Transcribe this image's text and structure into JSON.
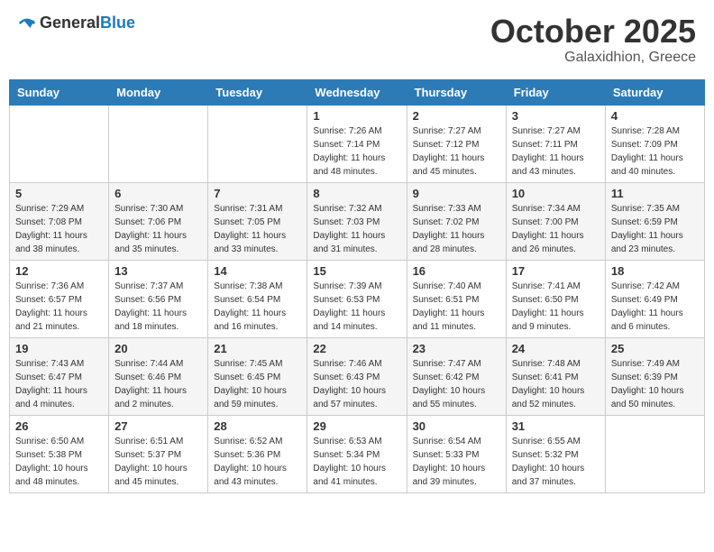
{
  "header": {
    "logo_general": "General",
    "logo_blue": "Blue",
    "month": "October 2025",
    "location": "Galaxidhion, Greece"
  },
  "weekdays": [
    "Sunday",
    "Monday",
    "Tuesday",
    "Wednesday",
    "Thursday",
    "Friday",
    "Saturday"
  ],
  "weeks": [
    [
      {
        "day": "",
        "sunrise": "",
        "sunset": "",
        "daylight": ""
      },
      {
        "day": "",
        "sunrise": "",
        "sunset": "",
        "daylight": ""
      },
      {
        "day": "",
        "sunrise": "",
        "sunset": "",
        "daylight": ""
      },
      {
        "day": "1",
        "sunrise": "Sunrise: 7:26 AM",
        "sunset": "Sunset: 7:14 PM",
        "daylight": "Daylight: 11 hours and 48 minutes."
      },
      {
        "day": "2",
        "sunrise": "Sunrise: 7:27 AM",
        "sunset": "Sunset: 7:12 PM",
        "daylight": "Daylight: 11 hours and 45 minutes."
      },
      {
        "day": "3",
        "sunrise": "Sunrise: 7:27 AM",
        "sunset": "Sunset: 7:11 PM",
        "daylight": "Daylight: 11 hours and 43 minutes."
      },
      {
        "day": "4",
        "sunrise": "Sunrise: 7:28 AM",
        "sunset": "Sunset: 7:09 PM",
        "daylight": "Daylight: 11 hours and 40 minutes."
      }
    ],
    [
      {
        "day": "5",
        "sunrise": "Sunrise: 7:29 AM",
        "sunset": "Sunset: 7:08 PM",
        "daylight": "Daylight: 11 hours and 38 minutes."
      },
      {
        "day": "6",
        "sunrise": "Sunrise: 7:30 AM",
        "sunset": "Sunset: 7:06 PM",
        "daylight": "Daylight: 11 hours and 35 minutes."
      },
      {
        "day": "7",
        "sunrise": "Sunrise: 7:31 AM",
        "sunset": "Sunset: 7:05 PM",
        "daylight": "Daylight: 11 hours and 33 minutes."
      },
      {
        "day": "8",
        "sunrise": "Sunrise: 7:32 AM",
        "sunset": "Sunset: 7:03 PM",
        "daylight": "Daylight: 11 hours and 31 minutes."
      },
      {
        "day": "9",
        "sunrise": "Sunrise: 7:33 AM",
        "sunset": "Sunset: 7:02 PM",
        "daylight": "Daylight: 11 hours and 28 minutes."
      },
      {
        "day": "10",
        "sunrise": "Sunrise: 7:34 AM",
        "sunset": "Sunset: 7:00 PM",
        "daylight": "Daylight: 11 hours and 26 minutes."
      },
      {
        "day": "11",
        "sunrise": "Sunrise: 7:35 AM",
        "sunset": "Sunset: 6:59 PM",
        "daylight": "Daylight: 11 hours and 23 minutes."
      }
    ],
    [
      {
        "day": "12",
        "sunrise": "Sunrise: 7:36 AM",
        "sunset": "Sunset: 6:57 PM",
        "daylight": "Daylight: 11 hours and 21 minutes."
      },
      {
        "day": "13",
        "sunrise": "Sunrise: 7:37 AM",
        "sunset": "Sunset: 6:56 PM",
        "daylight": "Daylight: 11 hours and 18 minutes."
      },
      {
        "day": "14",
        "sunrise": "Sunrise: 7:38 AM",
        "sunset": "Sunset: 6:54 PM",
        "daylight": "Daylight: 11 hours and 16 minutes."
      },
      {
        "day": "15",
        "sunrise": "Sunrise: 7:39 AM",
        "sunset": "Sunset: 6:53 PM",
        "daylight": "Daylight: 11 hours and 14 minutes."
      },
      {
        "day": "16",
        "sunrise": "Sunrise: 7:40 AM",
        "sunset": "Sunset: 6:51 PM",
        "daylight": "Daylight: 11 hours and 11 minutes."
      },
      {
        "day": "17",
        "sunrise": "Sunrise: 7:41 AM",
        "sunset": "Sunset: 6:50 PM",
        "daylight": "Daylight: 11 hours and 9 minutes."
      },
      {
        "day": "18",
        "sunrise": "Sunrise: 7:42 AM",
        "sunset": "Sunset: 6:49 PM",
        "daylight": "Daylight: 11 hours and 6 minutes."
      }
    ],
    [
      {
        "day": "19",
        "sunrise": "Sunrise: 7:43 AM",
        "sunset": "Sunset: 6:47 PM",
        "daylight": "Daylight: 11 hours and 4 minutes."
      },
      {
        "day": "20",
        "sunrise": "Sunrise: 7:44 AM",
        "sunset": "Sunset: 6:46 PM",
        "daylight": "Daylight: 11 hours and 2 minutes."
      },
      {
        "day": "21",
        "sunrise": "Sunrise: 7:45 AM",
        "sunset": "Sunset: 6:45 PM",
        "daylight": "Daylight: 10 hours and 59 minutes."
      },
      {
        "day": "22",
        "sunrise": "Sunrise: 7:46 AM",
        "sunset": "Sunset: 6:43 PM",
        "daylight": "Daylight: 10 hours and 57 minutes."
      },
      {
        "day": "23",
        "sunrise": "Sunrise: 7:47 AM",
        "sunset": "Sunset: 6:42 PM",
        "daylight": "Daylight: 10 hours and 55 minutes."
      },
      {
        "day": "24",
        "sunrise": "Sunrise: 7:48 AM",
        "sunset": "Sunset: 6:41 PM",
        "daylight": "Daylight: 10 hours and 52 minutes."
      },
      {
        "day": "25",
        "sunrise": "Sunrise: 7:49 AM",
        "sunset": "Sunset: 6:39 PM",
        "daylight": "Daylight: 10 hours and 50 minutes."
      }
    ],
    [
      {
        "day": "26",
        "sunrise": "Sunrise: 6:50 AM",
        "sunset": "Sunset: 5:38 PM",
        "daylight": "Daylight: 10 hours and 48 minutes."
      },
      {
        "day": "27",
        "sunrise": "Sunrise: 6:51 AM",
        "sunset": "Sunset: 5:37 PM",
        "daylight": "Daylight: 10 hours and 45 minutes."
      },
      {
        "day": "28",
        "sunrise": "Sunrise: 6:52 AM",
        "sunset": "Sunset: 5:36 PM",
        "daylight": "Daylight: 10 hours and 43 minutes."
      },
      {
        "day": "29",
        "sunrise": "Sunrise: 6:53 AM",
        "sunset": "Sunset: 5:34 PM",
        "daylight": "Daylight: 10 hours and 41 minutes."
      },
      {
        "day": "30",
        "sunrise": "Sunrise: 6:54 AM",
        "sunset": "Sunset: 5:33 PM",
        "daylight": "Daylight: 10 hours and 39 minutes."
      },
      {
        "day": "31",
        "sunrise": "Sunrise: 6:55 AM",
        "sunset": "Sunset: 5:32 PM",
        "daylight": "Daylight: 10 hours and 37 minutes."
      },
      {
        "day": "",
        "sunrise": "",
        "sunset": "",
        "daylight": ""
      }
    ]
  ]
}
